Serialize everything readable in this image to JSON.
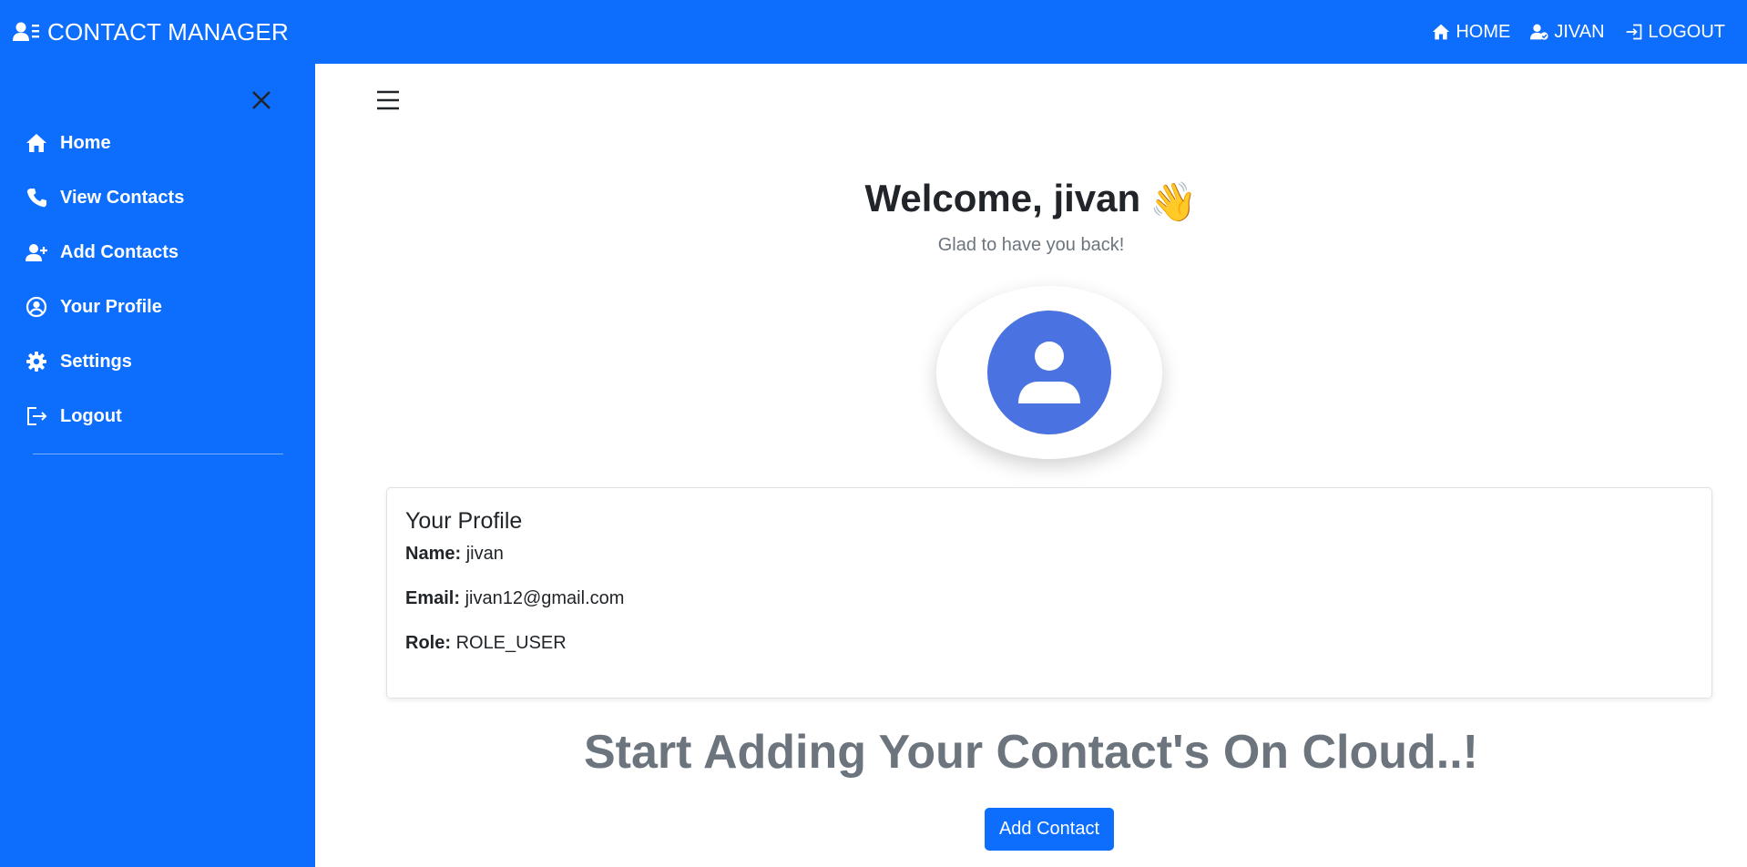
{
  "navbar": {
    "brand": "CONTACT MANAGER",
    "links": {
      "home": "HOME",
      "user": "JIVAN",
      "logout": "LOGOUT"
    }
  },
  "sidebar": {
    "items": [
      {
        "label": "Home",
        "icon": "home-icon"
      },
      {
        "label": "View Contacts",
        "icon": "phone-icon"
      },
      {
        "label": "Add Contacts",
        "icon": "user-plus-icon"
      },
      {
        "label": "Your Profile",
        "icon": "user-circle-icon"
      },
      {
        "label": "Settings",
        "icon": "gear-icon"
      },
      {
        "label": "Logout",
        "icon": "logout-icon"
      }
    ]
  },
  "main": {
    "welcome": "Welcome, jivan",
    "wave_emoji": "👋",
    "subtitle": "Glad to have you back!",
    "profile": {
      "title": "Your Profile",
      "name_label": "Name:",
      "name": "jivan",
      "email_label": "Email:",
      "email": "jivan12@gmail.com",
      "role_label": "Role:",
      "role": "ROLE_USER"
    },
    "cta_heading": "Start Adding Your Contact's On Cloud..!",
    "add_button": "Add Contact"
  },
  "colors": {
    "primary": "#0d6efd",
    "avatar": "#4a72e0",
    "muted": "#6c757d",
    "text": "#212529"
  }
}
